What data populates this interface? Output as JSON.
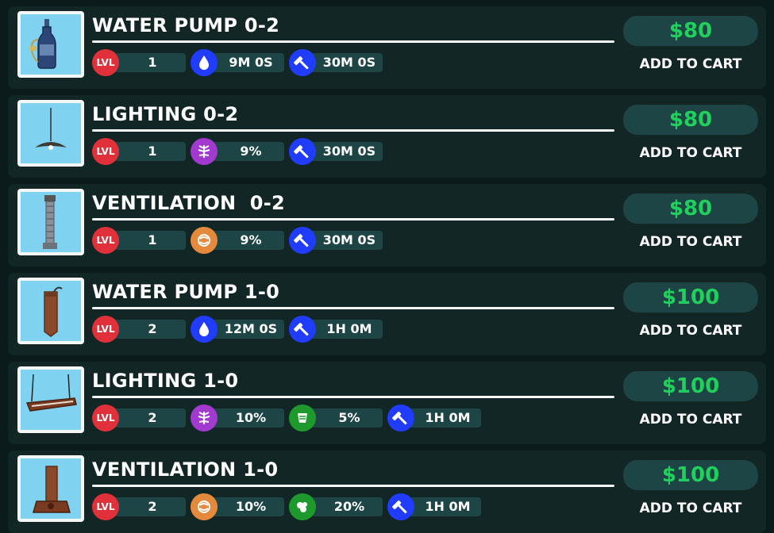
{
  "colors": {
    "background": "#0b1a1a",
    "row_bg": "#132626",
    "pill_bg": "#1d4545",
    "price_green": "#1fd15c",
    "lvl_red": "#e0303a",
    "water_blue": "#1f3cff",
    "light_purple": "#a23ad0",
    "vent_orange": "#e58a3c",
    "grow_green": "#1e9a2c",
    "thumb_bg": "#7fd3f0"
  },
  "shop": {
    "items": [
      {
        "name": "WATER PUMP 0-2",
        "image_icon": "water-pump-bottle-icon",
        "level_label": "LVL",
        "level": "1",
        "stats": [
          {
            "icon": "water-drop-icon",
            "value": "9M 0S"
          },
          {
            "icon": "hammer-icon",
            "value": "30M 0S"
          }
        ],
        "price": "$80",
        "cart_label": "ADD TO CART"
      },
      {
        "name": "LIGHTING 0-2",
        "image_icon": "hanging-lamp-icon",
        "level_label": "LVL",
        "level": "1",
        "stats": [
          {
            "icon": "light-boost-icon",
            "value": "9%"
          },
          {
            "icon": "hammer-icon",
            "value": "30M 0S"
          }
        ],
        "price": "$80",
        "cart_label": "ADD TO CART"
      },
      {
        "name": "VENTILATION  0-2",
        "image_icon": "vent-duct-icon",
        "level_label": "LVL",
        "level": "1",
        "stats": [
          {
            "icon": "airflow-icon",
            "value": "9%"
          },
          {
            "icon": "hammer-icon",
            "value": "30M 0S"
          }
        ],
        "price": "$80",
        "cart_label": "ADD TO CART"
      },
      {
        "name": "WATER PUMP 1-0",
        "image_icon": "wooden-pump-icon",
        "level_label": "LVL",
        "level": "2",
        "stats": [
          {
            "icon": "water-drop-icon",
            "value": "12M 0S"
          },
          {
            "icon": "hammer-icon",
            "value": "1H 0M"
          }
        ],
        "price": "$100",
        "cart_label": "ADD TO CART"
      },
      {
        "name": "LIGHTING 1-0",
        "image_icon": "grow-light-panel-icon",
        "level_label": "LVL",
        "level": "2",
        "stats": [
          {
            "icon": "light-boost-icon",
            "value": "10%"
          },
          {
            "icon": "yield-icon",
            "value": "5%"
          },
          {
            "icon": "hammer-icon",
            "value": "1H 0M"
          }
        ],
        "price": "$100",
        "cart_label": "ADD TO CART"
      },
      {
        "name": "VENTILATION 1-0",
        "image_icon": "wooden-vent-icon",
        "level_label": "LVL",
        "level": "2",
        "stats": [
          {
            "icon": "airflow-icon",
            "value": "10%"
          },
          {
            "icon": "growth-icon",
            "value": "20%"
          },
          {
            "icon": "hammer-icon",
            "value": "1H 0M"
          }
        ],
        "price": "$100",
        "cart_label": "ADD TO CART"
      }
    ]
  }
}
